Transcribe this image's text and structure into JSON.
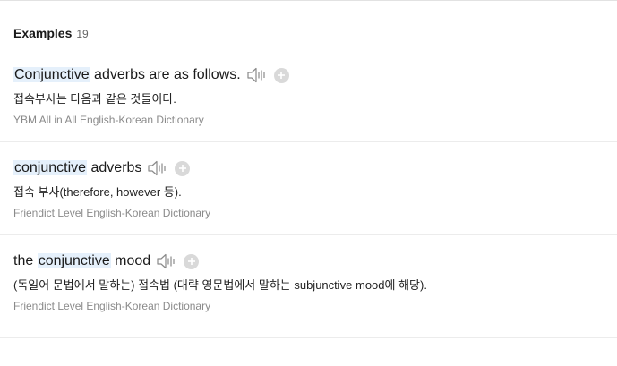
{
  "section": {
    "title": "Examples",
    "count": "19"
  },
  "icons": {
    "speaker": "speaker-icon",
    "add": "plus-circle-icon"
  },
  "colors": {
    "highlight": "#e5f0fb",
    "source_text": "#8a8a8a",
    "plus_bg": "#d9d9d9"
  },
  "examples": [
    {
      "before": "",
      "keyword": "Conjunctive",
      "after": " adverbs are as follows.",
      "translation": "접속부사는 다음과 같은 것들이다.",
      "source": "YBM All in All English-Korean Dictionary"
    },
    {
      "before": "",
      "keyword": "conjunctive",
      "after": " adverbs",
      "translation": "접속 부사(therefore, however 등).",
      "source": "Friendict Level English-Korean Dictionary"
    },
    {
      "before": "the ",
      "keyword": "conjunctive",
      "after": " mood",
      "translation": "(독일어 문법에서 말하는) 접속법 (대략 영문법에서 말하는 subjunctive mood에 해당).",
      "source": "Friendict Level English-Korean Dictionary"
    }
  ]
}
